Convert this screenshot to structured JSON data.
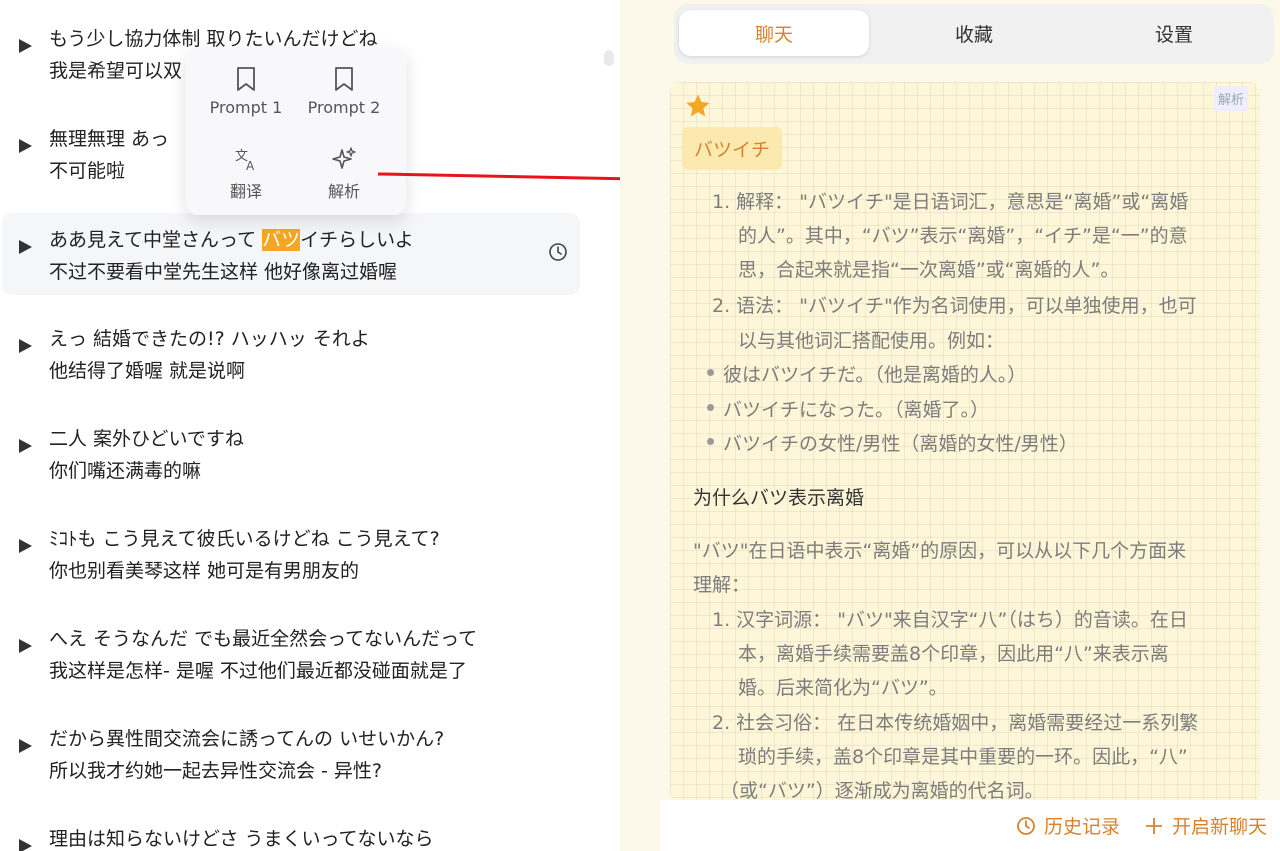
{
  "subtitles": [
    {
      "ja": "もう少し協力体制 取りたいんだけどね",
      "zh": "我是希望可以双"
    },
    {
      "ja": "無理無理 あっ",
      "zh": "不可能啦"
    },
    {
      "ja_pre": "ああ見えて中堂さんって ",
      "ja_hl": "バツ",
      "ja_post": "イチらしいよ",
      "zh": "不过不要看中堂先生这样 他好像离过婚喔"
    },
    {
      "ja": "えっ 結婚できたの!? ハッハッ それよ",
      "zh": "他结得了婚喔 就是说啊"
    },
    {
      "ja": "二人 案外ひどいですね",
      "zh": "你们嘴还满毒的嘛"
    },
    {
      "ja": "ﾐｺﾄも こう見えて彼氏いるけどね こう見えて?",
      "zh": "你也别看美琴这样 她可是有男朋友的"
    },
    {
      "ja": "へえ そうなんだ でも最近全然会ってないんだって",
      "zh": "我这样是怎样- 是喔 不过他们最近都没碰面就是了"
    },
    {
      "ja": "だから異性間交流会に誘ってんの いせいかん?",
      "zh": "所以我才约她一起去异性交流会 - 异性?"
    },
    {
      "ja": "理由は知らないけどさ うまくいってないなら",
      "zh": ""
    }
  ],
  "popup": {
    "prompt1": "Prompt 1",
    "prompt2": "Prompt 2",
    "translate": "翻译",
    "analyze": "解析"
  },
  "tabs": [
    "聊天",
    "收藏",
    "设置"
  ],
  "card": {
    "tag": "解析",
    "word": "バツイチ",
    "lines": [
      "1. 解释：  \"バツイチ\"是日语词汇，意思是“离婚”或“离婚",
      "的人”。其中，“バツ”表示“离婚”，“イチ”是“一”的意",
      "思，合起来就是指“一次离婚”或“离婚的人”。",
      "2. 语法：  \"バツイチ\"作为名词使用，可以单独使用，也可",
      "以与其他词汇搭配使用。例如：",
      "彼はバツイチだ。（他是离婚的人。）",
      "バツイチになった。（离婚了。）",
      "バツイチの女性/男性（离婚的女性/男性）",
      "为什么バツ表示离婚",
      "\"バツ\"在日语中表示“离婚”的原因，可以从以下几个方面来",
      "理解：",
      "1. 汉字词源：  \"バツ\"来自汉字“八”（はち）的音读。在日",
      "本，离婚手续需要盖8个印章，因此用“八”来表示离",
      "婚。后来简化为“バツ”。",
      "2. 社会习俗：  在日本传统婚姻中，离婚需要经过一系列繁",
      "琐的手续，盖8个印章是其中重要的一环。因此，“八”",
      "（或“バツ”）逐渐成为离婚的代名词。"
    ]
  },
  "bottom": {
    "history": "历史记录",
    "new_chat": "开启新聊天"
  },
  "colors": {
    "accent": "#d9822b",
    "highlight": "#f5a623",
    "arrow": "#e8141c"
  }
}
